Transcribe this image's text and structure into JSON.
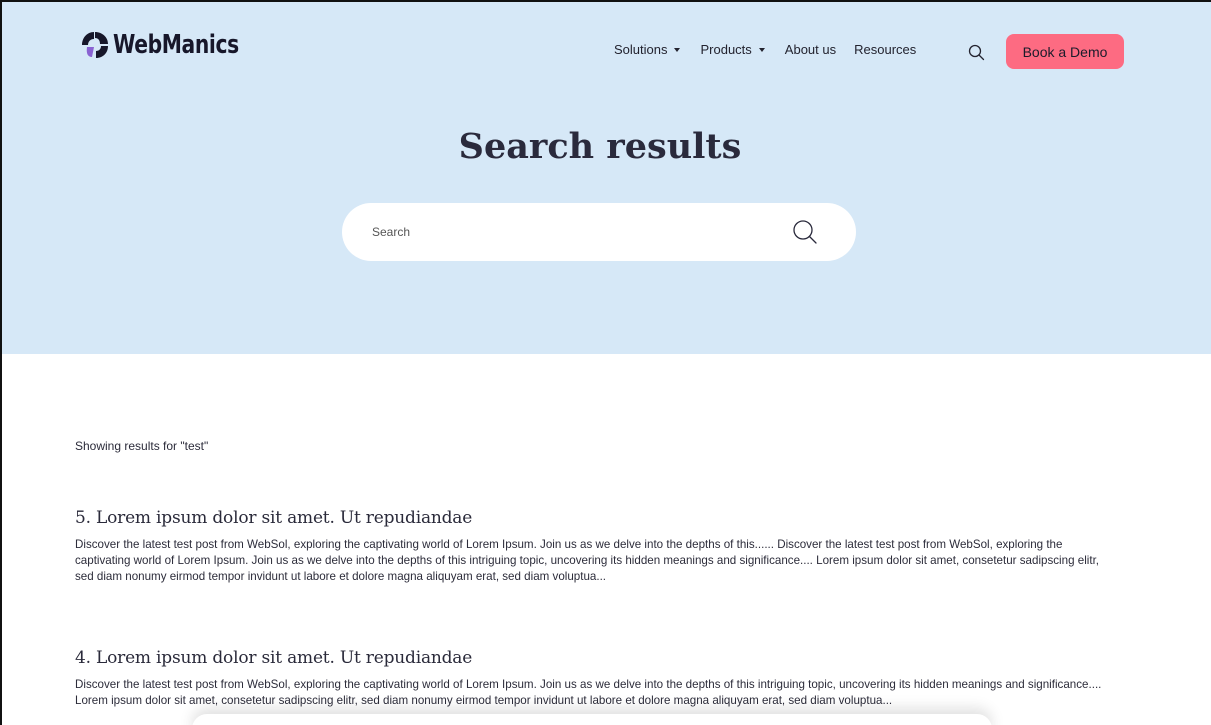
{
  "brand": {
    "name": "WebManics",
    "logo_colors": [
      "#17172a",
      "#8a63d2"
    ]
  },
  "nav": {
    "items": [
      {
        "label": "Solutions",
        "has_dropdown": true
      },
      {
        "label": "Products",
        "has_dropdown": true
      },
      {
        "label": "About us",
        "has_dropdown": false
      },
      {
        "label": "Resources",
        "has_dropdown": false
      }
    ],
    "search_icon": "search-icon",
    "cta_label": "Book a Demo"
  },
  "hero": {
    "title": "Search results",
    "search_placeholder": "Search",
    "search_icon": "search-icon"
  },
  "results": {
    "summary": "Showing results for \"test\"",
    "items": [
      {
        "title": "5. Lorem ipsum dolor sit amet. Ut repudiandae",
        "snippet": "Discover the latest test post from WebSol, exploring the captivating world of Lorem Ipsum. Join us as we delve into the depths of this...... Discover the latest test post from WebSol, exploring the captivating world of Lorem Ipsum. Join us as we delve into the depths of this intriguing topic, uncovering its hidden meanings and significance.... Lorem ipsum dolor sit amet, consetetur sadipscing elitr, sed diam nonumy eirmod tempor invidunt ut labore et dolore magna aliquyam erat, sed diam voluptua..."
      },
      {
        "title": "4. Lorem ipsum dolor sit amet. Ut repudiandae",
        "snippet": "Discover the latest test post from WebSol, exploring the captivating world of Lorem Ipsum. Join us as we delve into the depths of this intriguing topic, uncovering its hidden meanings and significance.... Lorem ipsum dolor sit amet, consetetur sadipscing elitr, sed diam nonumy eirmod tempor invidunt ut labore et dolore magna aliquyam erat, sed diam voluptua..."
      }
    ]
  },
  "colors": {
    "hero_background": "#d6e8f7",
    "cta_background": "#fd6b82",
    "text": "#2b2b3a"
  }
}
